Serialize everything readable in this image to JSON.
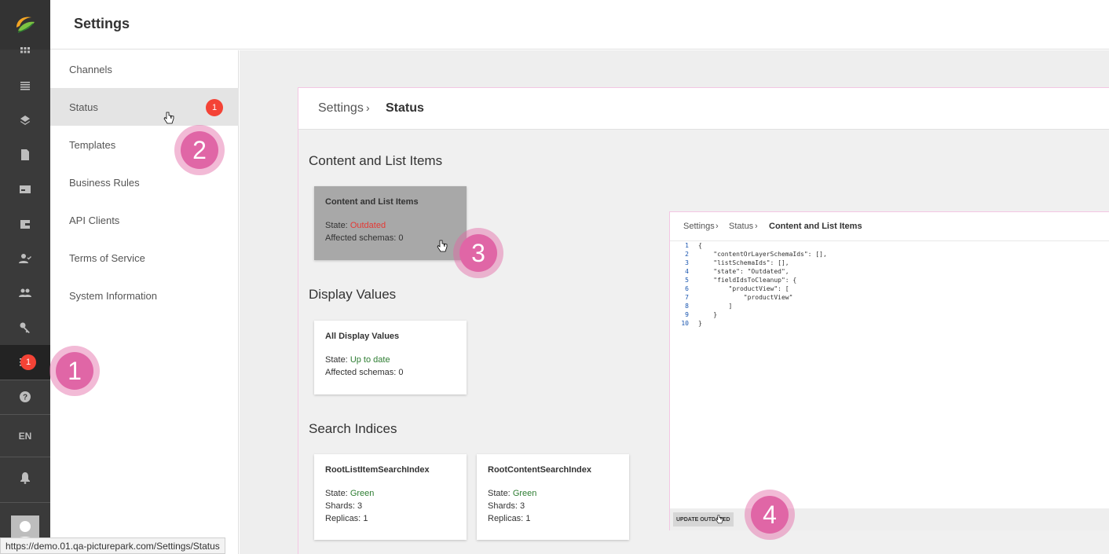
{
  "header": {
    "title": "Settings"
  },
  "rail": {
    "items": [
      {
        "icon": "dashboard-grid-icon"
      },
      {
        "icon": "list-icon"
      },
      {
        "icon": "layers-icon"
      },
      {
        "icon": "document-icon"
      },
      {
        "icon": "card-icon"
      },
      {
        "icon": "wallet-icon"
      },
      {
        "icon": "user-check-icon"
      },
      {
        "icon": "people-icon"
      },
      {
        "icon": "key-icon"
      },
      {
        "icon": "settings-sliders-icon"
      },
      {
        "icon": "help-icon"
      }
    ],
    "settings_badge": "1",
    "language": "EN",
    "bell_icon": "bell-icon",
    "avatar_icon": "avatar-icon"
  },
  "nav": {
    "items": [
      {
        "label": "Channels"
      },
      {
        "label": "Status"
      },
      {
        "label": "Templates"
      },
      {
        "label": "Business Rules"
      },
      {
        "label": "API Clients"
      },
      {
        "label": "Terms of Service"
      },
      {
        "label": "System Information"
      }
    ],
    "status_badge": "1"
  },
  "breadcrumb": {
    "root": "Settings",
    "current": "Status"
  },
  "sections": {
    "content": "Content and List Items",
    "display": "Display Values",
    "search": "Search Indices"
  },
  "cards": {
    "content": {
      "title": "Content and List Items",
      "state_label": "State:",
      "state": "Outdated",
      "affected_label": "Affected schemas:",
      "affected": "0"
    },
    "display": {
      "title": "All Display Values",
      "state_label": "State:",
      "state": "Up to date",
      "affected_label": "Affected schemas:",
      "affected": "0"
    },
    "root_list": {
      "title": "RootListItemSearchIndex",
      "state_label": "State:",
      "state": "Green",
      "shards_label": "Shards:",
      "shards": "3",
      "replicas_label": "Replicas:",
      "replicas": "1"
    },
    "root_content": {
      "title": "RootContentSearchIndex",
      "state_label": "State:",
      "state": "Green",
      "shards_label": "Shards:",
      "shards": "3",
      "replicas_label": "Replicas:",
      "replicas": "1"
    }
  },
  "json_panel": {
    "breadcrumb": [
      "Settings",
      "Status",
      "Content and List Items"
    ],
    "lines": [
      {
        "n": "1",
        "t": "{"
      },
      {
        "n": "2",
        "t": "    \"contentOrLayerSchemaIds\": [],"
      },
      {
        "n": "3",
        "t": "    \"listSchemaIds\": [],"
      },
      {
        "n": "4",
        "t": "    \"state\": \"Outdated\","
      },
      {
        "n": "5",
        "t": "    \"fieldIdsToCleanup\": {"
      },
      {
        "n": "6",
        "t": "        \"productView\": ["
      },
      {
        "n": "7",
        "t": "            \"productView\""
      },
      {
        "n": "8",
        "t": "        ]"
      },
      {
        "n": "9",
        "t": "    }"
      },
      {
        "n": "10",
        "t": "}"
      }
    ],
    "update_button": "UPDATE OUTDATED"
  },
  "steps": [
    "1",
    "2",
    "3",
    "4"
  ],
  "status_url": "https://demo.01.qa-picturepark.com/Settings/Status",
  "colors": {
    "rail": "#3a3a3a",
    "badge": "#f44336",
    "step": "#e066a6",
    "state_ok": "#2e7d32",
    "state_outdated": "#e53935"
  }
}
